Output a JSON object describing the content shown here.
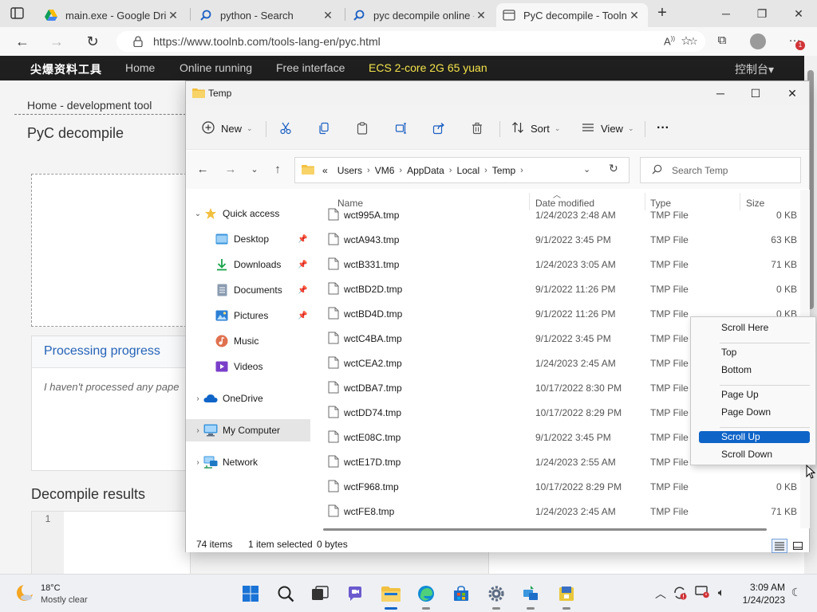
{
  "browser": {
    "tabs": [
      {
        "label": "main.exe - Google Driv",
        "icon": "google-drive-icon"
      },
      {
        "label": "python - Search",
        "icon": "search-icon"
      },
      {
        "label": "pyc decompile online -",
        "icon": "search-icon"
      },
      {
        "label": "PyC decompile - Toolnb",
        "icon": "page-icon",
        "active": true
      }
    ],
    "url": "https://www.toolnb.com/tools-lang-en/pyc.html",
    "profile_badge": "1"
  },
  "site": {
    "logo": "尖爆资料工具",
    "nav": [
      "Home",
      "Online running",
      "Free interface"
    ],
    "promo": "ECS 2-core 2G 65 yuan",
    "console": "控制台▾",
    "breadcrumb": "Home - development tool",
    "page_title": "PyC decompile",
    "progress_title": "Processing progress",
    "progress_text": "I haven't processed any pape",
    "results_title": "Decompile results",
    "editor_line": "1"
  },
  "explorer": {
    "title": "Temp",
    "commands": {
      "new": "New",
      "sort": "Sort",
      "view": "View",
      "more": "···"
    },
    "path": [
      "«",
      "Users",
      "VM6",
      "AppData",
      "Local",
      "Temp"
    ],
    "search_placeholder": "Search Temp",
    "nav": [
      {
        "label": "Quick access",
        "icon": "star-icon"
      },
      {
        "label": "Desktop",
        "icon": "desktop-icon",
        "pinned": true
      },
      {
        "label": "Downloads",
        "icon": "download-icon",
        "pinned": true
      },
      {
        "label": "Documents",
        "icon": "document-icon",
        "pinned": true
      },
      {
        "label": "Pictures",
        "icon": "picture-icon",
        "pinned": true
      },
      {
        "label": "Music",
        "icon": "music-icon"
      },
      {
        "label": "Videos",
        "icon": "video-icon"
      },
      {
        "label": "OneDrive",
        "icon": "cloud-icon"
      },
      {
        "label": "My Computer",
        "icon": "computer-icon",
        "selected": true
      },
      {
        "label": "Network",
        "icon": "network-icon"
      }
    ],
    "columns": {
      "name": "Name",
      "date": "Date modified",
      "type": "Type",
      "size": "Size"
    },
    "files": [
      {
        "name": "wct995A.tmp",
        "date": "1/24/2023 2:48 AM",
        "type": "TMP File",
        "size": "0 KB"
      },
      {
        "name": "wctA943.tmp",
        "date": "9/1/2022 3:45 PM",
        "type": "TMP File",
        "size": "63 KB"
      },
      {
        "name": "wctB331.tmp",
        "date": "1/24/2023 3:05 AM",
        "type": "TMP File",
        "size": "71 KB"
      },
      {
        "name": "wctBD2D.tmp",
        "date": "9/1/2022 11:26 PM",
        "type": "TMP File",
        "size": "0 KB"
      },
      {
        "name": "wctBD4D.tmp",
        "date": "9/1/2022 11:26 PM",
        "type": "TMP File",
        "size": "0 KB"
      },
      {
        "name": "wctC4BA.tmp",
        "date": "9/1/2022 3:45 PM",
        "type": "TMP File",
        "size": ""
      },
      {
        "name": "wctCEA2.tmp",
        "date": "1/24/2023 2:45 AM",
        "type": "TMP File",
        "size": ""
      },
      {
        "name": "wctDBA7.tmp",
        "date": "10/17/2022 8:30 PM",
        "type": "TMP File",
        "size": ""
      },
      {
        "name": "wctDD74.tmp",
        "date": "10/17/2022 8:29 PM",
        "type": "TMP File",
        "size": ""
      },
      {
        "name": "wctE08C.tmp",
        "date": "9/1/2022 3:45 PM",
        "type": "TMP File",
        "size": ""
      },
      {
        "name": "wctE17D.tmp",
        "date": "1/24/2023 2:55 AM",
        "type": "TMP File",
        "size": ""
      },
      {
        "name": "wctF968.tmp",
        "date": "10/17/2022 8:29 PM",
        "type": "TMP File",
        "size": "0 KB"
      },
      {
        "name": "wctFE8.tmp",
        "date": "1/24/2023 2:45 AM",
        "type": "TMP File",
        "size": "71 KB"
      }
    ],
    "status": {
      "count": "74 items",
      "selection": "1 item selected",
      "bytes": "0 bytes"
    }
  },
  "context_menu": [
    {
      "label": "Scroll Here"
    },
    {
      "sep": true
    },
    {
      "label": "Top"
    },
    {
      "label": "Bottom"
    },
    {
      "sep": true
    },
    {
      "label": "Page Up"
    },
    {
      "label": "Page Down"
    },
    {
      "sep": true
    },
    {
      "label": "Scroll Up",
      "highlighted": true
    },
    {
      "label": "Scroll Down"
    }
  ],
  "taskbar": {
    "weather_temp": "18°C",
    "weather_cond": "Mostly clear",
    "time": "3:09 AM",
    "date": "1/24/2023"
  },
  "colors": {
    "accent": "#0f64c8",
    "folder": "#f2c040",
    "promo": "#f5e54a"
  }
}
